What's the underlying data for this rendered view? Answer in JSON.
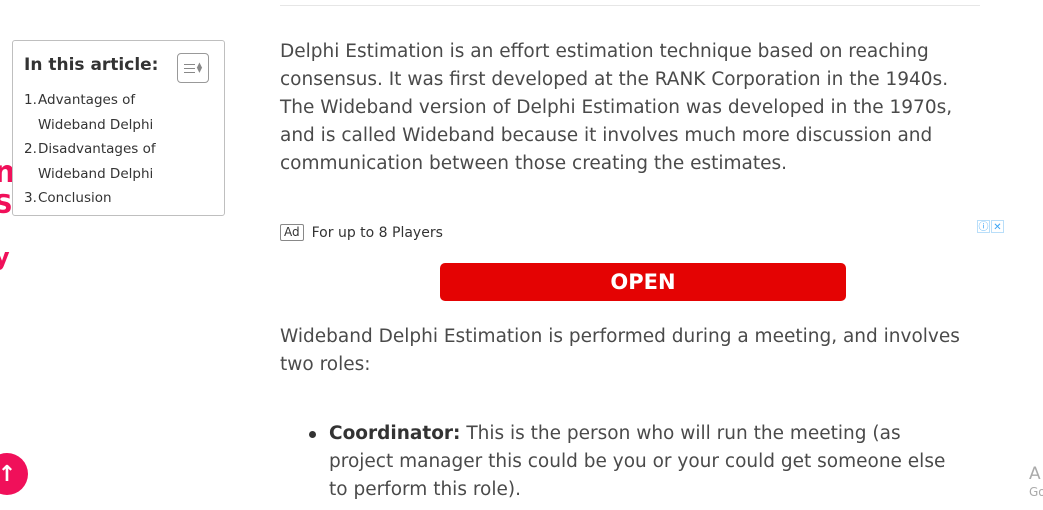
{
  "side_fragments": [
    "n",
    "S",
    "y"
  ],
  "toc": {
    "title": "In this article:",
    "toggle_icon": "list-toggle-icon",
    "items": [
      {
        "num": "1.",
        "label": "Advantages of Wideband Delphi"
      },
      {
        "num": "2.",
        "label": "Disadvantages of Wideband Delphi"
      },
      {
        "num": "3.",
        "label": "Conclusion"
      }
    ]
  },
  "content": {
    "intro": "Delphi Estimation is an effort estimation technique based on reaching consensus. It was first developed at the RANK Corporation in the 1940s. The Wideband version of Delphi Estimation was developed in the 1970s, and is called Wideband because it involves much more discussion and communication between those creating the estimates.",
    "roles_intro": "Wideband Delphi Estimation is performed during a meeting, and involves two roles:",
    "bullets": [
      {
        "term": "Coordinator:",
        "text": " This is the person who will run the meeting (as project manager this could be you or your could get someone else to perform this role)."
      }
    ]
  },
  "ad": {
    "badge": "Ad",
    "headline": "For up to 8 Players",
    "info_icon": "ⓘ",
    "close_icon": "✕",
    "button_label": "OPEN",
    "button_color": "#e40303"
  },
  "scroll_top": {
    "icon": "↑",
    "color": "#f0105a"
  },
  "corner": {
    "big": "A",
    "small": "Go"
  }
}
